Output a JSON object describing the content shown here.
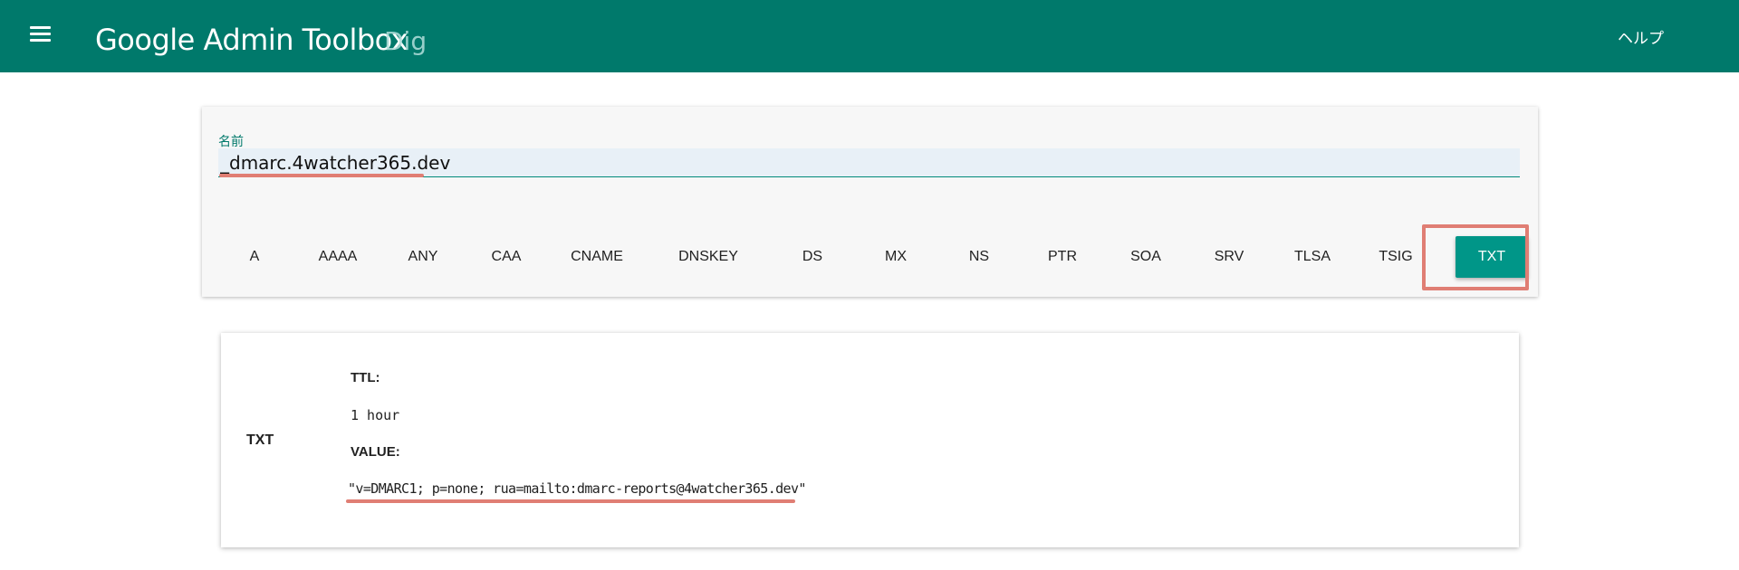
{
  "header": {
    "title": "Google Admin Toolbox",
    "subtitle": "Dig",
    "help_label": "ヘルプ",
    "icons": {
      "menu": "hamburger-menu-icon"
    },
    "background_color": "#00796b"
  },
  "query": {
    "name_label": "名前",
    "name_value": "_dmarc.4watcher365.dev",
    "record_types": [
      {
        "label": "A"
      },
      {
        "label": "AAAA"
      },
      {
        "label": "ANY"
      },
      {
        "label": "CAA"
      },
      {
        "label": "CNAME"
      },
      {
        "label": "DNSKEY"
      },
      {
        "label": "DS"
      },
      {
        "label": "MX"
      },
      {
        "label": "NS"
      },
      {
        "label": "PTR"
      },
      {
        "label": "SOA"
      },
      {
        "label": "SRV"
      },
      {
        "label": "TLSA"
      },
      {
        "label": "TSIG"
      },
      {
        "label": "TXT"
      }
    ],
    "selected_type": "TXT",
    "accent_color": "#009688",
    "highlight_color": "#e07e74"
  },
  "result": {
    "type": "TXT",
    "ttl_label": "TTL:",
    "ttl_value": "1 hour",
    "value_label": "VALUE:",
    "value": "\"v=DMARC1; p=none; rua=mailto:dmarc-reports@4watcher365.dev\""
  }
}
